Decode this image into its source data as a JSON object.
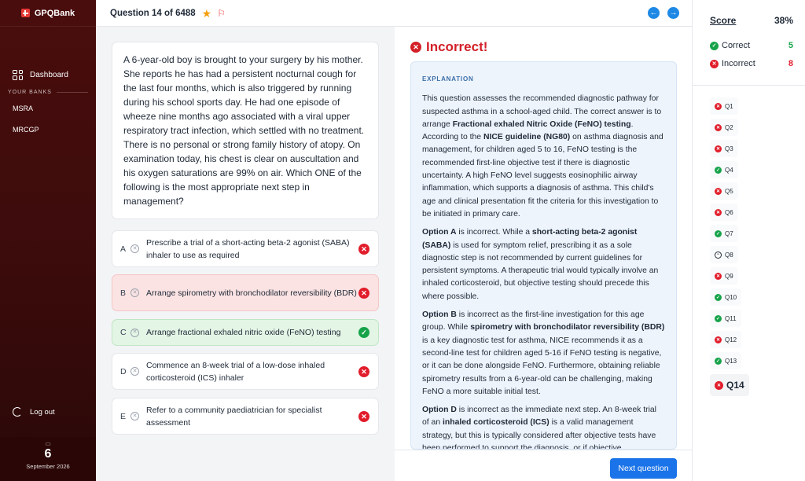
{
  "app": {
    "brand": "GPQBank"
  },
  "sidebar": {
    "dashboard": "Dashboard",
    "section_label": "YOUR BANKS",
    "banks": [
      "MSRA",
      "MRCGP"
    ],
    "logout": "Log out",
    "date": {
      "day": "6",
      "month_year": "September 2026"
    }
  },
  "topbar": {
    "question_count": "Question 14 of 6488"
  },
  "question": {
    "stem": "A 6-year-old boy is brought to your surgery by his mother. She reports he has had a persistent nocturnal cough for the last four months, which is also triggered by running during his school sports day. He had one episode of wheeze nine months ago associated with a viral upper respiratory tract infection, which settled with no treatment. There is no personal or strong family history of atopy. On examination today, his chest is clear on auscultation and his oxygen saturations are 99% on air. Which ONE of the following is the most appropriate next step in management?",
    "options": [
      {
        "letter": "A",
        "text": "Prescribe a trial of a short-acting beta-2 agonist (SABA) inhaler to use as required",
        "state": "wrong"
      },
      {
        "letter": "B",
        "text": "Arrange spirometry with bronchodilator reversibility (BDR)",
        "state": "selected-wrong"
      },
      {
        "letter": "C",
        "text": "Arrange fractional exhaled nitric oxide (FeNO) testing",
        "state": "correct"
      },
      {
        "letter": "D",
        "text": "Commence an 8-week trial of a low-dose inhaled corticosteroid (ICS) inhaler",
        "state": "wrong"
      },
      {
        "letter": "E",
        "text": "Refer to a community paediatrician for specialist assessment",
        "state": "wrong"
      }
    ]
  },
  "result": {
    "label": "Incorrect!"
  },
  "explanation": {
    "heading": "EXPLANATION",
    "p1_a": "This question assesses the recommended diagnostic pathway for suspected asthma in a school-aged child. The correct answer is to arrange ",
    "p1_b": "Fractional exhaled Nitric Oxide (FeNO) testing",
    "p1_c": ". According to the ",
    "p1_d": "NICE guideline (NG80)",
    "p1_e": " on asthma diagnosis and management, for children aged 5 to 16, FeNO testing is the recommended first-line objective test if there is diagnostic uncertainty. A high FeNO level suggests eosinophilic airway inflammation, which supports a diagnosis of asthma. This child's age and clinical presentation fit the criteria for this investigation to be initiated in primary care.",
    "p2_a": "Option A",
    "p2_b": " is incorrect. While a ",
    "p2_c": "short-acting beta-2 agonist (SABA)",
    "p2_d": " is used for symptom relief, prescribing it as a sole diagnostic step is not recommended by current guidelines for persistent symptoms. A therapeutic trial would typically involve an inhaled corticosteroid, but objective testing should precede this where possible.",
    "p3_a": "Option B",
    "p3_b": " is incorrect as the first-line investigation for this age group. While ",
    "p3_c": "spirometry with bronchodilator reversibility (BDR)",
    "p3_d": " is a key diagnostic test for asthma, NICE recommends it as a second-line test for children aged 5-16 if FeNO testing is negative, or it can be done alongside FeNO. Furthermore, obtaining reliable spirometry results from a 6-year-old can be challenging, making FeNO a more suitable initial test.",
    "p4_a": "Option D",
    "p4_b": " is incorrect as the immediate next step. An 8-week trial of an ",
    "p4_c": "inhaled corticosteroid (ICS)",
    "p4_d": " is a valid management strategy, but this is typically considered after objective tests have been performed to support the diagnosis, or if objective"
  },
  "next_button": "Next question",
  "score": {
    "label": "Score",
    "percent": "38%",
    "correct_label": "Correct",
    "correct_count": "5",
    "incorrect_label": "Incorrect",
    "incorrect_count": "8"
  },
  "question_list": [
    {
      "label": "Q1",
      "status": "incorrect"
    },
    {
      "label": "Q2",
      "status": "incorrect"
    },
    {
      "label": "Q3",
      "status": "incorrect"
    },
    {
      "label": "Q4",
      "status": "correct"
    },
    {
      "label": "Q5",
      "status": "incorrect"
    },
    {
      "label": "Q6",
      "status": "incorrect"
    },
    {
      "label": "Q7",
      "status": "correct"
    },
    {
      "label": "Q8",
      "status": "skipped"
    },
    {
      "label": "Q9",
      "status": "incorrect"
    },
    {
      "label": "Q10",
      "status": "correct"
    },
    {
      "label": "Q11",
      "status": "correct"
    },
    {
      "label": "Q12",
      "status": "incorrect"
    },
    {
      "label": "Q13",
      "status": "correct"
    },
    {
      "label": "Q14",
      "status": "incorrect"
    }
  ],
  "colors": {
    "accent": "#1a73e8",
    "correct": "#16a34a",
    "incorrect": "#e11d2b",
    "sidebar": "#4a0d0d"
  }
}
